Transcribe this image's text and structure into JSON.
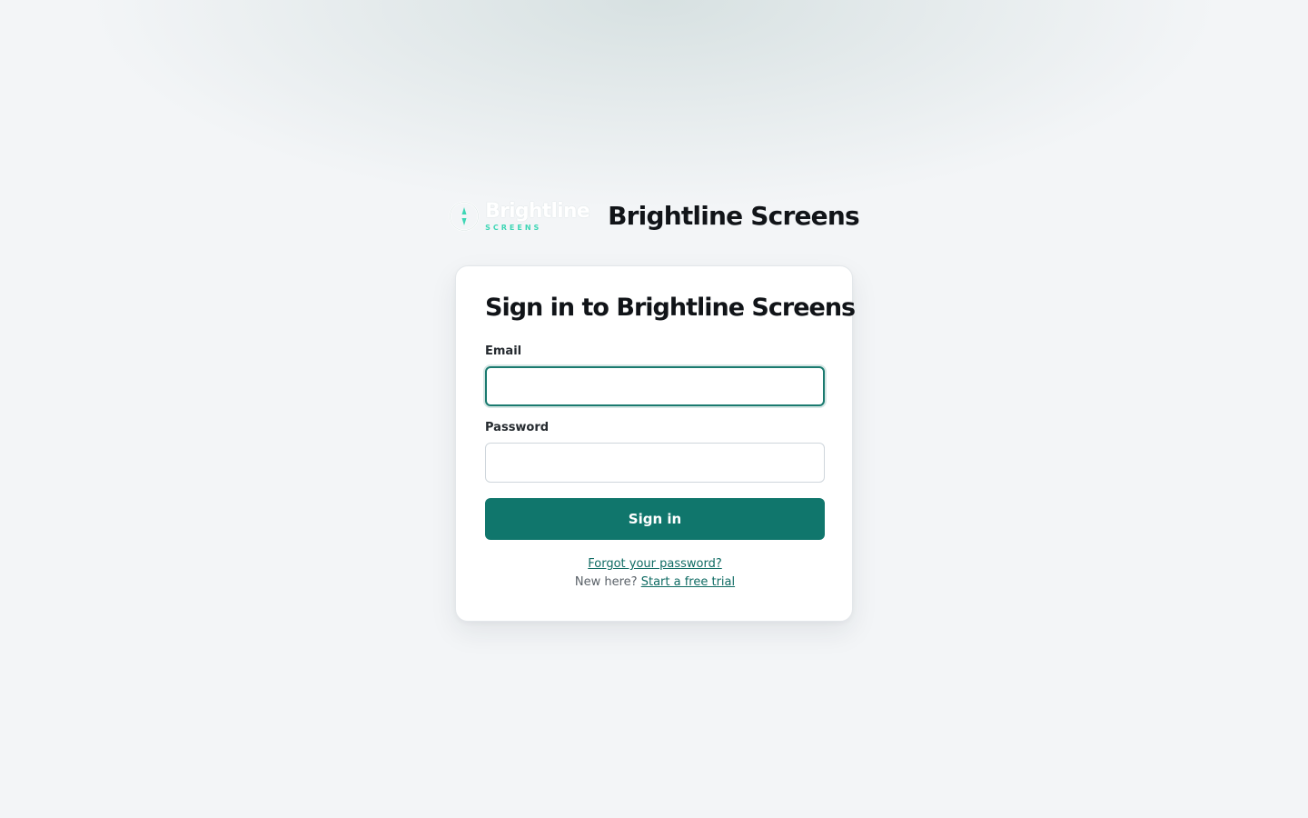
{
  "brand": {
    "logo_word": "Brightline",
    "logo_sub": "SCREENS",
    "name": "Brightline Screens",
    "logo_icon": "compass-icon",
    "colors": {
      "accent": "#10766c",
      "logo_accent": "#3ed6b5",
      "focus_ring": "#1a7a6f"
    }
  },
  "form": {
    "title": "Sign in to Brightline Screens",
    "email_label": "Email",
    "email_value": "",
    "password_label": "Password",
    "password_value": "",
    "submit_label": "Sign in"
  },
  "footer": {
    "forgot_link": "Forgot your password?",
    "new_prompt": "New here?",
    "trial_link": "Start a free trial"
  }
}
